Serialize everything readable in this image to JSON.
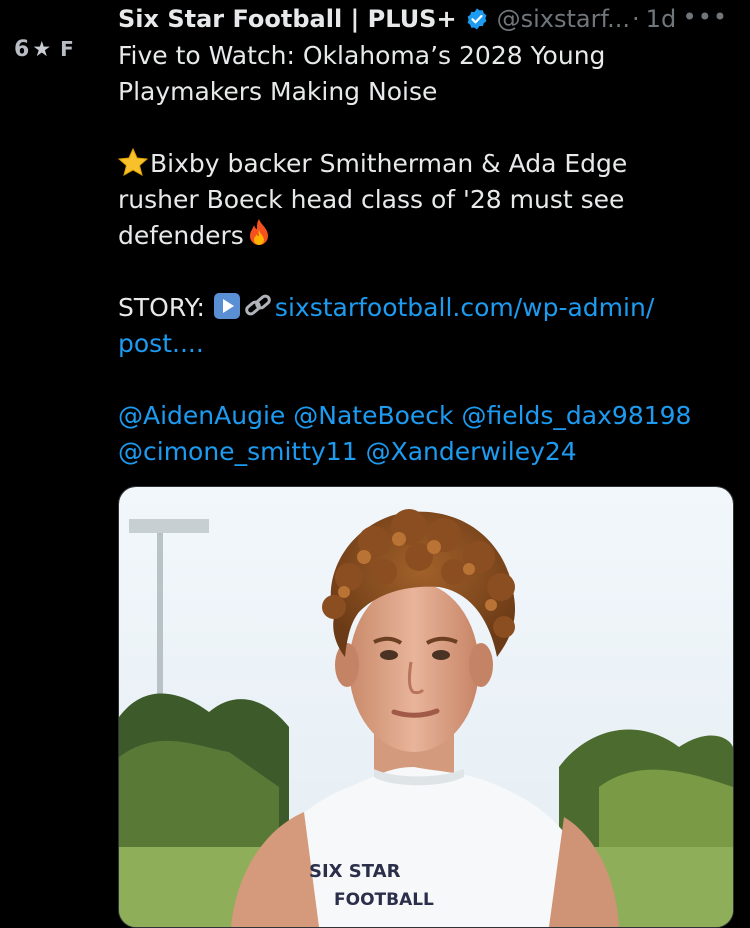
{
  "author": {
    "avatar_text_left": "6",
    "avatar_text_right": "F",
    "name": "Six Star Football | PLUS+",
    "handle": "@sixstarf...",
    "separator": "·",
    "time": "1d",
    "more_label": "•••"
  },
  "tweet": {
    "title_line1": "Five to Watch: Oklahoma’s 2028 Young",
    "title_line2": "Playmakers Making Noise",
    "para1_line1": "Bixby backer Smitherman  & Ada Edge",
    "para1_line2": "rusher Boeck head class of '28 must see",
    "para1_line3": "defenders",
    "story_label": "STORY:",
    "link_part1": "sixstarfootball.com/wp-admin/",
    "link_part2": "post....",
    "mentions_line1": [
      "@AidenAugie",
      "@NateBoeck",
      "@fields_dax98198"
    ],
    "mentions_line2": [
      "@cimone_smitty11",
      "@Xanderwiley24"
    ]
  },
  "media": {
    "jersey_text": "SIX STAR",
    "jersey_text2": "FOOTBALL"
  },
  "colors": {
    "background": "#000000",
    "text": "#e7e9ea",
    "muted": "#71767b",
    "link": "#1d9bf0",
    "verified": "#1d9bf0"
  }
}
